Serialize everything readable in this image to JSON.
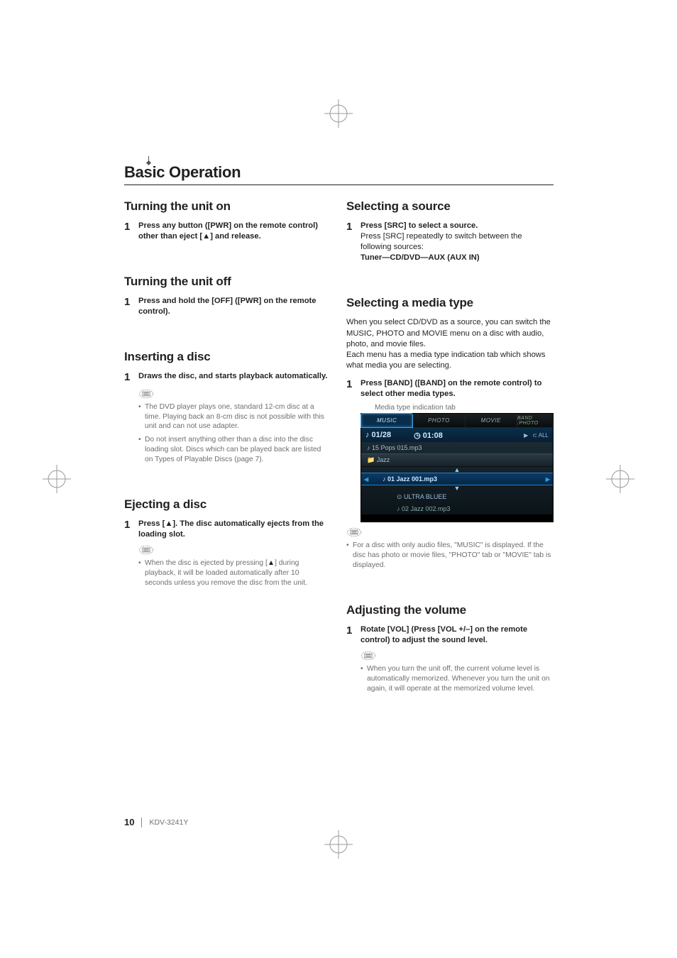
{
  "page": {
    "number": "10",
    "model": "KDV-3241Y",
    "chapter_title": "Basic Operation"
  },
  "left": {
    "turn_on": {
      "title": "Turning the unit on",
      "step_num": "1",
      "step_text_before": "Press any button ([PWR] on the remote control) other than eject [",
      "step_eject": "▲",
      "step_text_after": "] and release."
    },
    "turn_off": {
      "title": "Turning the unit off",
      "step_num": "1",
      "step_text": "Press and hold the [OFF] ([PWR] on the remote control)."
    },
    "insert": {
      "title": "Inserting a disc",
      "step_num": "1",
      "step_text": "Draws the disc, and starts playback automatically.",
      "notes": [
        "The DVD player plays one, standard 12-cm disc at a time. Playing back an 8-cm disc is not possible with this unit and can not use adapter.",
        "Do not insert anything other than a disc into the disc loading slot. Discs which can be played back are listed on Types of Playable Discs (page 7)."
      ]
    },
    "eject": {
      "title": "Ejecting a disc",
      "step_num": "1",
      "step_text_before": "Press [",
      "step_eject": "▲",
      "step_text_after": "]. The disc automatically ejects from the loading slot.",
      "note_before": "When the disc is ejected by pressing [",
      "note_eject": "▲",
      "note_after": "] during playback, it will be loaded automatically after 10 seconds unless you remove the disc from the unit."
    }
  },
  "right": {
    "source": {
      "title": "Selecting a source",
      "step_num": "1",
      "step_bold": "Press [SRC] to select a source.",
      "step_plain": "Press [SRC] repeatedly to switch between the following sources:",
      "step_sources": "Tuner—CD/DVD—AUX (AUX IN)"
    },
    "media": {
      "title": "Selecting a media type",
      "intro": "When you select CD/DVD as a source, you can switch the MUSIC, PHOTO and MOVIE menu on a disc with audio, photo, and movie files.\nEach menu has a media type indication tab which shows what media you are selecting.",
      "step_num": "1",
      "step_text": "Press [BAND] ([BAND] on the remote control) to select other media types.",
      "caption": "Media type indication tab",
      "shot": {
        "tab_music": "MUSIC",
        "tab_photo": "PHOTO",
        "tab_movie": "MOVIE",
        "tab_band": "BAND :PHOTO",
        "track_pos": "♪ 01/28",
        "time": "◷ 01:08",
        "play_icon": "▶",
        "repeat": "⊂ ALL",
        "header": "♪ 15  Pops  015.mp3",
        "folder": "📁 Jazz",
        "up": "▲",
        "current": "♪  01  Jazz  001.mp3",
        "down": "▼",
        "album": "⊙ ULTRA  BLUEE",
        "next": "♪ 02  Jazz  002.mp3"
      },
      "note": "For a disc with only audio files, \"MUSIC\" is displayed. If the disc has photo or movie files, \"PHOTO\" tab or \"MOVIE\" tab is displayed."
    },
    "volume": {
      "title": "Adjusting the volume",
      "step_num": "1",
      "step_text": "Rotate [VOL] (Press [VOL +/–] on the remote control) to adjust the sound level.",
      "note": "When you turn the unit off, the current volume level is automatically memorized. Whenever you turn the unit on again, it will operate at the memorized volume level."
    }
  }
}
